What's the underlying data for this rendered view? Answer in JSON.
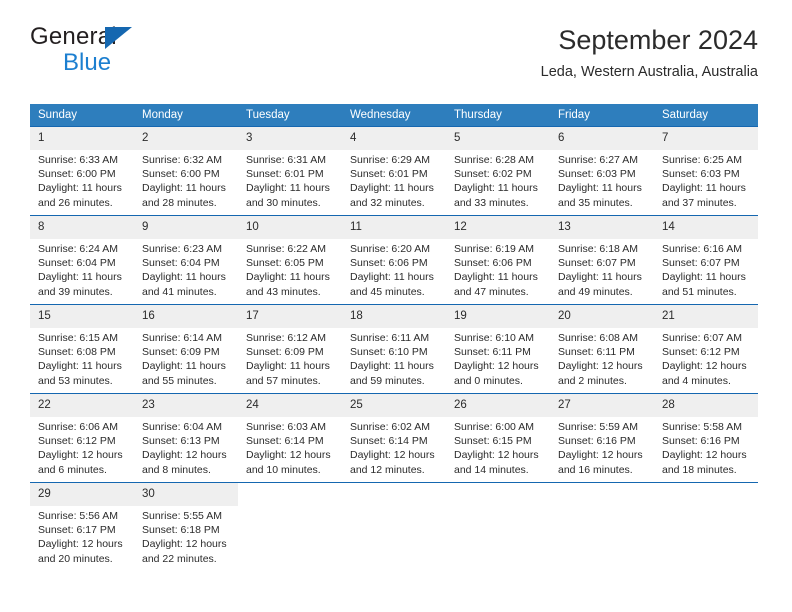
{
  "brand": {
    "word_one": "General",
    "word_two": "Blue",
    "triangle_color": "#1567b0"
  },
  "header": {
    "title": "September 2024",
    "location": "Leda, Western Australia, Australia"
  },
  "colors": {
    "header_blue": "#2e7ebd",
    "rule_blue": "#1567b0",
    "daynum_band": "#efefef",
    "text": "#2b2b2b"
  },
  "weekdays": [
    "Sunday",
    "Monday",
    "Tuesday",
    "Wednesday",
    "Thursday",
    "Friday",
    "Saturday"
  ],
  "weeks": [
    [
      {
        "day": "1",
        "sunrise": "Sunrise: 6:33 AM",
        "sunset": "Sunset: 6:00 PM",
        "daylight_1": "Daylight: 11 hours",
        "daylight_2": "and 26 minutes."
      },
      {
        "day": "2",
        "sunrise": "Sunrise: 6:32 AM",
        "sunset": "Sunset: 6:00 PM",
        "daylight_1": "Daylight: 11 hours",
        "daylight_2": "and 28 minutes."
      },
      {
        "day": "3",
        "sunrise": "Sunrise: 6:31 AM",
        "sunset": "Sunset: 6:01 PM",
        "daylight_1": "Daylight: 11 hours",
        "daylight_2": "and 30 minutes."
      },
      {
        "day": "4",
        "sunrise": "Sunrise: 6:29 AM",
        "sunset": "Sunset: 6:01 PM",
        "daylight_1": "Daylight: 11 hours",
        "daylight_2": "and 32 minutes."
      },
      {
        "day": "5",
        "sunrise": "Sunrise: 6:28 AM",
        "sunset": "Sunset: 6:02 PM",
        "daylight_1": "Daylight: 11 hours",
        "daylight_2": "and 33 minutes."
      },
      {
        "day": "6",
        "sunrise": "Sunrise: 6:27 AM",
        "sunset": "Sunset: 6:03 PM",
        "daylight_1": "Daylight: 11 hours",
        "daylight_2": "and 35 minutes."
      },
      {
        "day": "7",
        "sunrise": "Sunrise: 6:25 AM",
        "sunset": "Sunset: 6:03 PM",
        "daylight_1": "Daylight: 11 hours",
        "daylight_2": "and 37 minutes."
      }
    ],
    [
      {
        "day": "8",
        "sunrise": "Sunrise: 6:24 AM",
        "sunset": "Sunset: 6:04 PM",
        "daylight_1": "Daylight: 11 hours",
        "daylight_2": "and 39 minutes."
      },
      {
        "day": "9",
        "sunrise": "Sunrise: 6:23 AM",
        "sunset": "Sunset: 6:04 PM",
        "daylight_1": "Daylight: 11 hours",
        "daylight_2": "and 41 minutes."
      },
      {
        "day": "10",
        "sunrise": "Sunrise: 6:22 AM",
        "sunset": "Sunset: 6:05 PM",
        "daylight_1": "Daylight: 11 hours",
        "daylight_2": "and 43 minutes."
      },
      {
        "day": "11",
        "sunrise": "Sunrise: 6:20 AM",
        "sunset": "Sunset: 6:06 PM",
        "daylight_1": "Daylight: 11 hours",
        "daylight_2": "and 45 minutes."
      },
      {
        "day": "12",
        "sunrise": "Sunrise: 6:19 AM",
        "sunset": "Sunset: 6:06 PM",
        "daylight_1": "Daylight: 11 hours",
        "daylight_2": "and 47 minutes."
      },
      {
        "day": "13",
        "sunrise": "Sunrise: 6:18 AM",
        "sunset": "Sunset: 6:07 PM",
        "daylight_1": "Daylight: 11 hours",
        "daylight_2": "and 49 minutes."
      },
      {
        "day": "14",
        "sunrise": "Sunrise: 6:16 AM",
        "sunset": "Sunset: 6:07 PM",
        "daylight_1": "Daylight: 11 hours",
        "daylight_2": "and 51 minutes."
      }
    ],
    [
      {
        "day": "15",
        "sunrise": "Sunrise: 6:15 AM",
        "sunset": "Sunset: 6:08 PM",
        "daylight_1": "Daylight: 11 hours",
        "daylight_2": "and 53 minutes."
      },
      {
        "day": "16",
        "sunrise": "Sunrise: 6:14 AM",
        "sunset": "Sunset: 6:09 PM",
        "daylight_1": "Daylight: 11 hours",
        "daylight_2": "and 55 minutes."
      },
      {
        "day": "17",
        "sunrise": "Sunrise: 6:12 AM",
        "sunset": "Sunset: 6:09 PM",
        "daylight_1": "Daylight: 11 hours",
        "daylight_2": "and 57 minutes."
      },
      {
        "day": "18",
        "sunrise": "Sunrise: 6:11 AM",
        "sunset": "Sunset: 6:10 PM",
        "daylight_1": "Daylight: 11 hours",
        "daylight_2": "and 59 minutes."
      },
      {
        "day": "19",
        "sunrise": "Sunrise: 6:10 AM",
        "sunset": "Sunset: 6:11 PM",
        "daylight_1": "Daylight: 12 hours",
        "daylight_2": "and 0 minutes."
      },
      {
        "day": "20",
        "sunrise": "Sunrise: 6:08 AM",
        "sunset": "Sunset: 6:11 PM",
        "daylight_1": "Daylight: 12 hours",
        "daylight_2": "and 2 minutes."
      },
      {
        "day": "21",
        "sunrise": "Sunrise: 6:07 AM",
        "sunset": "Sunset: 6:12 PM",
        "daylight_1": "Daylight: 12 hours",
        "daylight_2": "and 4 minutes."
      }
    ],
    [
      {
        "day": "22",
        "sunrise": "Sunrise: 6:06 AM",
        "sunset": "Sunset: 6:12 PM",
        "daylight_1": "Daylight: 12 hours",
        "daylight_2": "and 6 minutes."
      },
      {
        "day": "23",
        "sunrise": "Sunrise: 6:04 AM",
        "sunset": "Sunset: 6:13 PM",
        "daylight_1": "Daylight: 12 hours",
        "daylight_2": "and 8 minutes."
      },
      {
        "day": "24",
        "sunrise": "Sunrise: 6:03 AM",
        "sunset": "Sunset: 6:14 PM",
        "daylight_1": "Daylight: 12 hours",
        "daylight_2": "and 10 minutes."
      },
      {
        "day": "25",
        "sunrise": "Sunrise: 6:02 AM",
        "sunset": "Sunset: 6:14 PM",
        "daylight_1": "Daylight: 12 hours",
        "daylight_2": "and 12 minutes."
      },
      {
        "day": "26",
        "sunrise": "Sunrise: 6:00 AM",
        "sunset": "Sunset: 6:15 PM",
        "daylight_1": "Daylight: 12 hours",
        "daylight_2": "and 14 minutes."
      },
      {
        "day": "27",
        "sunrise": "Sunrise: 5:59 AM",
        "sunset": "Sunset: 6:16 PM",
        "daylight_1": "Daylight: 12 hours",
        "daylight_2": "and 16 minutes."
      },
      {
        "day": "28",
        "sunrise": "Sunrise: 5:58 AM",
        "sunset": "Sunset: 6:16 PM",
        "daylight_1": "Daylight: 12 hours",
        "daylight_2": "and 18 minutes."
      }
    ],
    [
      {
        "day": "29",
        "sunrise": "Sunrise: 5:56 AM",
        "sunset": "Sunset: 6:17 PM",
        "daylight_1": "Daylight: 12 hours",
        "daylight_2": "and 20 minutes."
      },
      {
        "day": "30",
        "sunrise": "Sunrise: 5:55 AM",
        "sunset": "Sunset: 6:18 PM",
        "daylight_1": "Daylight: 12 hours",
        "daylight_2": "and 22 minutes."
      },
      null,
      null,
      null,
      null,
      null
    ]
  ]
}
